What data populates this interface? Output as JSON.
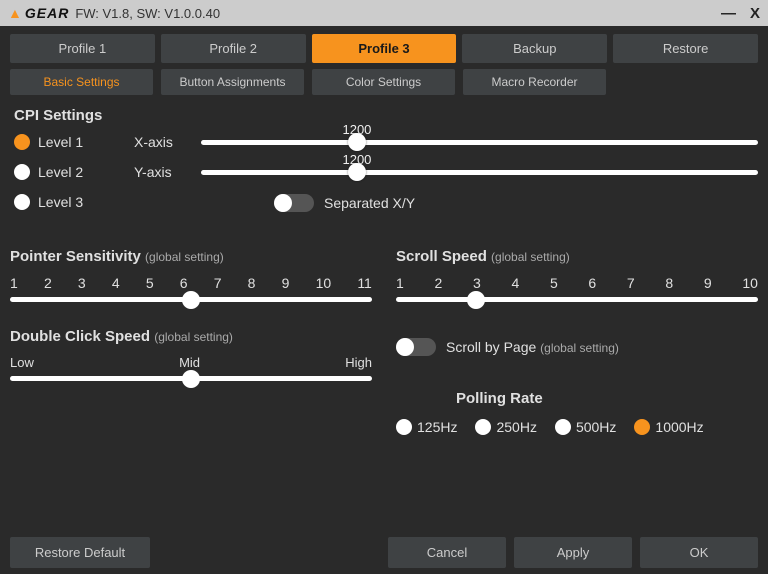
{
  "title": {
    "brand": "GEAR",
    "version": "FW: V1.8, SW: V1.0.0.40"
  },
  "tabs": {
    "profile1": "Profile 1",
    "profile2": "Profile 2",
    "profile3": "Profile 3",
    "backup": "Backup",
    "restore": "Restore",
    "active": "profile3"
  },
  "subtabs": {
    "basic": "Basic Settings",
    "buttons": "Button Assignments",
    "color": "Color Settings",
    "macro": "Macro Recorder",
    "active": "basic"
  },
  "cpi": {
    "title": "CPI Settings",
    "levels": [
      "Level 1",
      "Level 2",
      "Level 3"
    ],
    "active_level": 0,
    "x_label": "X-axis",
    "y_label": "Y-axis",
    "x_value": "1200",
    "y_value": "1200",
    "x_pos_pct": 28,
    "y_pos_pct": 28,
    "sep_label": "Separated X/Y",
    "sep_on": false
  },
  "pointer": {
    "title": "Pointer Sensitivity",
    "note": "(global setting)",
    "ticks": [
      "1",
      "2",
      "3",
      "4",
      "5",
      "6",
      "7",
      "8",
      "9",
      "10",
      "11"
    ],
    "selected_pct": 50
  },
  "scroll": {
    "title": "Scroll Speed",
    "note": "(global setting)",
    "ticks": [
      "1",
      "2",
      "3",
      "4",
      "5",
      "6",
      "7",
      "8",
      "9",
      "10"
    ],
    "selected_pct": 22
  },
  "double_click": {
    "title": "Double Click Speed",
    "note": "(global setting)",
    "labels": {
      "low": "Low",
      "mid": "Mid",
      "high": "High"
    },
    "selected_pct": 50
  },
  "scroll_by_page": {
    "label": "Scroll by Page",
    "note": "(global setting)",
    "on": false
  },
  "polling": {
    "title": "Polling Rate",
    "options": [
      "125Hz",
      "250Hz",
      "500Hz",
      "1000Hz"
    ],
    "active": 3
  },
  "footer": {
    "restore_default": "Restore Default",
    "cancel": "Cancel",
    "apply": "Apply",
    "ok": "OK"
  }
}
